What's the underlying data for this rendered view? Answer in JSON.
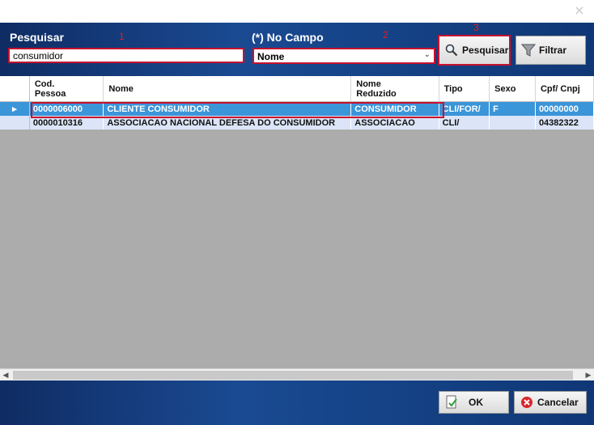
{
  "window": {
    "close_glyph": "×"
  },
  "search": {
    "label": "Pesquisar",
    "marker": "1",
    "value": "consumidor"
  },
  "field": {
    "label": "(*) No Campo",
    "marker": "2",
    "selected": "Nome"
  },
  "buttons": {
    "pesquisar": "Pesquisar",
    "pesquisar_marker": "3",
    "filtrar": "Filtrar",
    "ok": "OK",
    "cancelar": "Cancelar"
  },
  "table": {
    "columns": [
      {
        "line1": "Cod.",
        "line2": "Pessoa"
      },
      {
        "line1": "Nome",
        "line2": ""
      },
      {
        "line1": "Nome",
        "line2": "Reduzido"
      },
      {
        "line1": "Tipo",
        "line2": ""
      },
      {
        "line1": "Sexo",
        "line2": ""
      },
      {
        "line1": "Cpf/ Cnpj",
        "line2": ""
      }
    ],
    "rows": [
      {
        "cod": "0000006000",
        "nome": "CLIENTE CONSUMIDOR",
        "reduzido": "CONSUMIDOR",
        "tipo": "CLI/FOR/",
        "sexo": "F",
        "cpf": "00000000",
        "selected": true
      },
      {
        "cod": "0000010316",
        "nome": "ASSOCIACAO NACIONAL DEFESA DO CONSUMIDOR",
        "reduzido": "ASSOCIACAO",
        "tipo": "CLI/",
        "sexo": "",
        "cpf": "04382322",
        "selected": false
      }
    ]
  },
  "colors": {
    "panel": "#1a4a92",
    "highlight": "#c8102e",
    "selected_row": "#3b95d9",
    "grid_bg": "#acacac"
  }
}
